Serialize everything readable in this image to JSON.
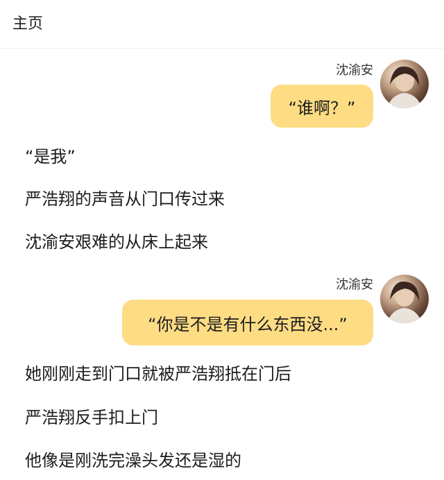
{
  "header": {
    "title": "主页"
  },
  "messages": [
    {
      "speaker": "沈渝安",
      "text": "“谁啊？”"
    },
    {
      "speaker": "沈渝安",
      "text": "“你是不是有什么东西没...”"
    }
  ],
  "narration": [
    "“是我”",
    "严浩翔的声音从门口传过来",
    "沈渝安艰难的从床上起来",
    "她刚刚走到门口就被严浩翔抵在门后",
    "严浩翔反手扣上门",
    "他像是刚洗完澡头发还是湿的"
  ],
  "colors": {
    "bubble": "#fddc84",
    "background": "#ffffff"
  },
  "icons": {
    "avatar": "avatar-photo"
  }
}
